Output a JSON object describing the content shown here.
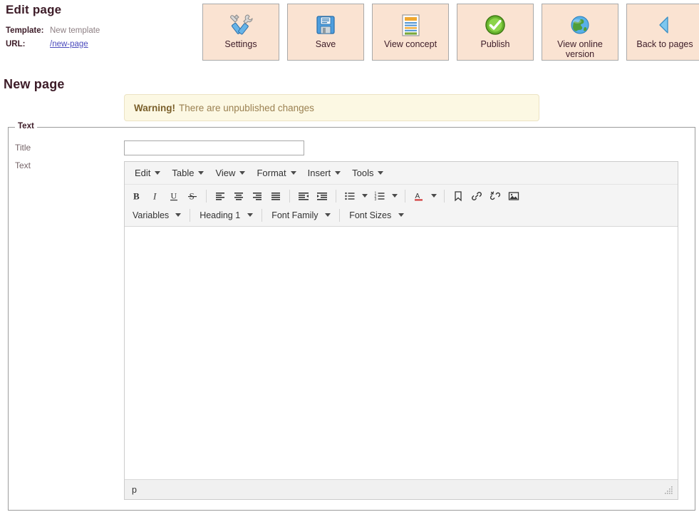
{
  "page": {
    "edit_title": "Edit page",
    "heading": "New page",
    "meta": [
      {
        "label": "Template:",
        "value": "New template",
        "is_link": false
      },
      {
        "label": "URL:",
        "value": "/new-page",
        "is_link": true
      }
    ]
  },
  "actions": [
    {
      "label": "Settings",
      "icon": "tools-icon",
      "name": "settings-button"
    },
    {
      "label": "Save",
      "icon": "floppy-disk-icon",
      "name": "save-button"
    },
    {
      "label": "View concept",
      "icon": "document-icon",
      "name": "view-concept-button"
    },
    {
      "label": "Publish",
      "icon": "check-circle-icon",
      "name": "publish-button"
    },
    {
      "label": "View online version",
      "icon": "globe-icon",
      "name": "view-online-version-button"
    },
    {
      "label": "Back to pages",
      "icon": "back-arrow-icon",
      "name": "back-to-pages-button"
    }
  ],
  "warning": {
    "strong": "Warning!",
    "text": "There are unpublished changes"
  },
  "fieldset": {
    "legend": "Text",
    "title_label": "Title",
    "text_label": "Text",
    "title_value": "",
    "title_placeholder": ""
  },
  "editor": {
    "menubar": [
      "Edit",
      "Table",
      "View",
      "Format",
      "Insert",
      "Tools"
    ],
    "toolbar_row1": [
      {
        "name": "bold-icon",
        "title": "Bold"
      },
      {
        "name": "italic-icon",
        "title": "Italic"
      },
      {
        "name": "underline-icon",
        "title": "Underline"
      },
      {
        "name": "strikethrough-icon",
        "title": "Strikethrough"
      },
      {
        "name": "align-left-icon",
        "title": "Align left"
      },
      {
        "name": "align-center-icon",
        "title": "Align center"
      },
      {
        "name": "align-right-icon",
        "title": "Align right"
      },
      {
        "name": "align-justify-icon",
        "title": "Justify"
      },
      {
        "name": "outdent-icon",
        "title": "Decrease indent"
      },
      {
        "name": "indent-icon",
        "title": "Increase indent"
      },
      {
        "name": "bullet-list-icon",
        "title": "Bullet list"
      },
      {
        "name": "numbered-list-icon",
        "title": "Numbered list"
      },
      {
        "name": "text-color-icon",
        "title": "Text colour"
      },
      {
        "name": "anchor-icon",
        "title": "Anchor"
      },
      {
        "name": "link-icon",
        "title": "Insert link"
      },
      {
        "name": "unlink-icon",
        "title": "Remove link"
      },
      {
        "name": "image-icon",
        "title": "Insert image"
      }
    ],
    "toolbar_row2": [
      {
        "label": "Variables",
        "name": "variables-select"
      },
      {
        "label": "Heading 1",
        "name": "block-format-select"
      },
      {
        "label": "Font Family",
        "name": "font-family-select"
      },
      {
        "label": "Font Sizes",
        "name": "font-size-select"
      }
    ],
    "content": "",
    "statusbar_path": "p"
  },
  "colors": {
    "button_bg": "#fae3d2",
    "button_border": "#a9a9a9",
    "heading": "#3d1c28",
    "link": "#4b4bbd",
    "warning_bg": "#fcf8e3",
    "warning_border": "#ece3c4",
    "warning_text": "#9b8152",
    "toolbar_bg": "#f4f4f4",
    "statusbar_bg": "#f0f0f0"
  }
}
